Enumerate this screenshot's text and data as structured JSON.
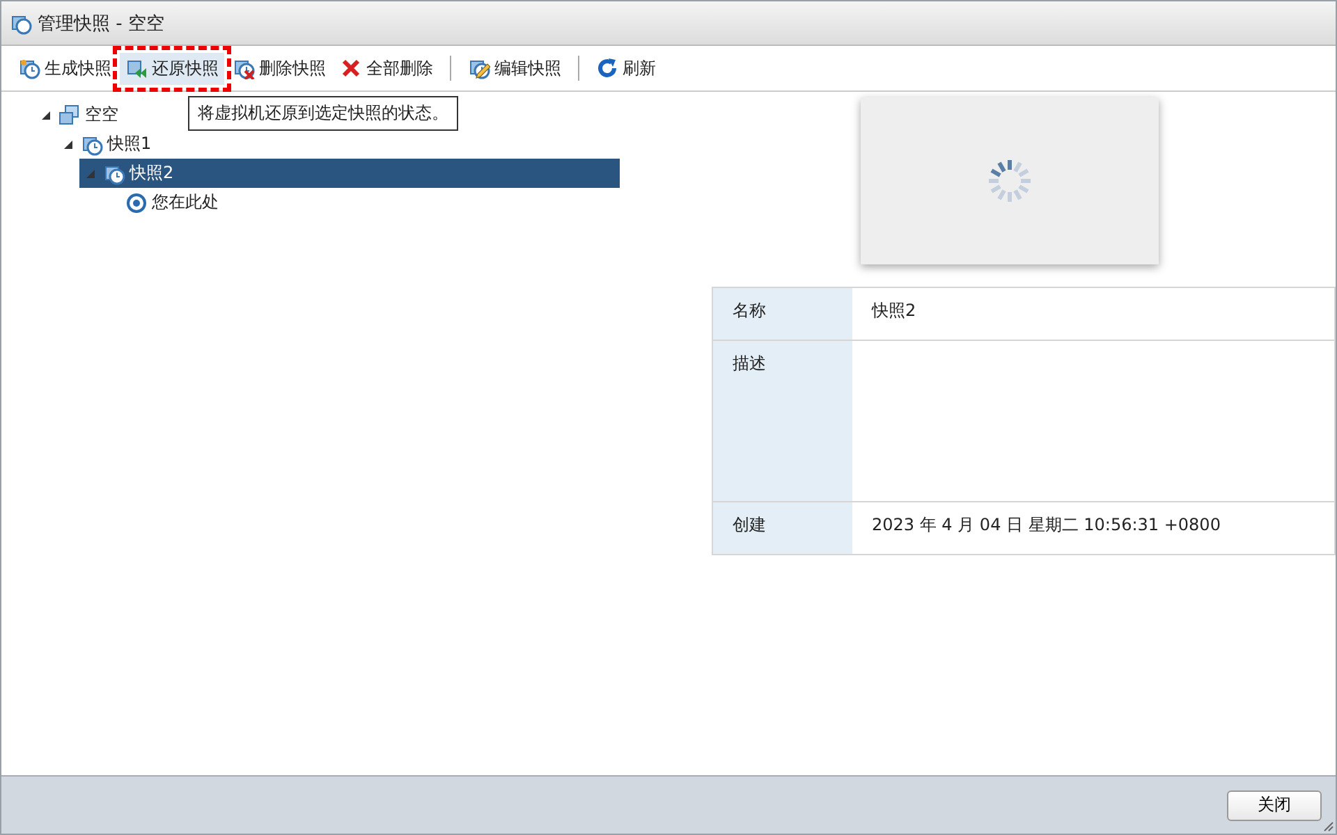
{
  "window": {
    "title": "管理快照 - 空空"
  },
  "toolbar": [
    {
      "label": "生成快照",
      "kind": "take",
      "highlighted": false,
      "divider_before": false
    },
    {
      "label": "还原快照",
      "kind": "revert",
      "highlighted": true,
      "divider_before": false
    },
    {
      "label": "删除快照",
      "kind": "delete",
      "highlighted": false,
      "divider_before": false
    },
    {
      "label": "全部删除",
      "kind": "delete_all",
      "highlighted": false,
      "divider_before": false
    },
    {
      "label": "编辑快照",
      "kind": "edit",
      "highlighted": false,
      "divider_before": true
    },
    {
      "label": "刷新",
      "kind": "refresh",
      "highlighted": false,
      "divider_before": true
    }
  ],
  "tooltip": "将虚拟机还原到选定快照的状态。",
  "tree": [
    {
      "label": "空空",
      "kind": "vm",
      "expanded": true,
      "selected": false,
      "children": [
        {
          "label": "快照1",
          "kind": "snapshot",
          "expanded": true,
          "selected": false,
          "children": [
            {
              "label": "快照2",
              "kind": "snapshot",
              "expanded": true,
              "selected": true,
              "children": [
                {
                  "label": "您在此处",
                  "kind": "here",
                  "selected": false
                }
              ]
            }
          ]
        }
      ]
    }
  ],
  "details": [
    {
      "label": "名称",
      "value": "快照2",
      "kind": "short"
    },
    {
      "label": "描述",
      "kind": "tall"
    },
    {
      "label": "创建",
      "value": "2023 年 4 月 04 日 星期二 10:56:31 +0800",
      "kind": "short"
    }
  ],
  "buttons": [
    "关闭"
  ]
}
